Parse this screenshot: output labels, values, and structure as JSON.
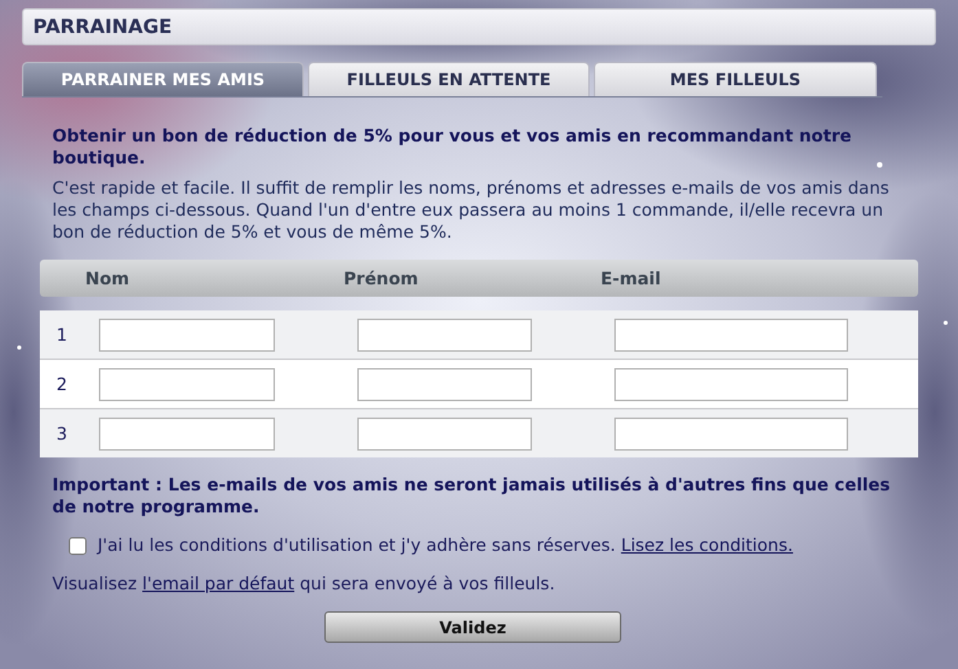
{
  "title": "PARRAINAGE",
  "tabs": [
    {
      "label": "PARRAINER MES AMIS",
      "selected": true
    },
    {
      "label": "FILLEULS EN ATTENTE",
      "selected": false
    },
    {
      "label": "MES FILLEULS",
      "selected": false
    }
  ],
  "headline": "Obtenir un bon de réduction de 5% pour vous et vos amis en recommandant notre boutique.",
  "intro": "C'est rapide et facile. Il suffit de remplir les noms, prénoms et adresses e-mails de vos amis dans les champs ci-dessous. Quand l'un d'entre eux passera au moins 1 commande, il/elle recevra un bon de réduction de 5% et vous de même 5%.",
  "table": {
    "columns": [
      "Nom",
      "Prénom",
      "E-mail"
    ],
    "rows": [
      {
        "number": "1"
      },
      {
        "number": "2"
      },
      {
        "number": "3"
      }
    ]
  },
  "important": "Important : Les e-mails de vos amis ne seront jamais utilisés à d'autres fins que celles de notre programme.",
  "agreement": {
    "checked": false,
    "text": "J'ai lu les conditions d'utilisation et j'y adhère sans réserves.",
    "link": "Lisez les conditions."
  },
  "preview": {
    "before": "Visualisez",
    "link": "l'email par défaut",
    "after": "qui sera envoyé à vos filleuls."
  },
  "submit": "Validez"
}
